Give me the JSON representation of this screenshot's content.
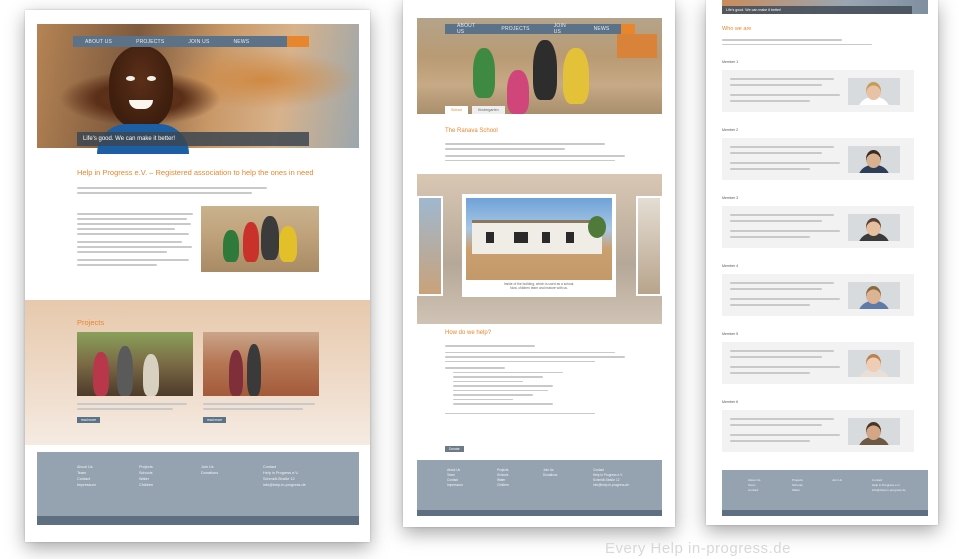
{
  "page1": {
    "nav": [
      "ABOUT US",
      "PROJECTS",
      "JOIN US",
      "NEWS"
    ],
    "hero_caption": "Life's good. We can make it better!",
    "headline": "Help in Progress e.V. – Registered association to help the ones in need",
    "projects_title": "Projects",
    "read_more": "read more",
    "footer": {
      "col1": [
        "About Us",
        "Team",
        "Contact",
        "Impressum"
      ],
      "col2": [
        "Projects",
        "Schools",
        "Water",
        "Children"
      ],
      "col3": [
        "Join Us",
        "Donations"
      ],
      "col4": [
        "Contact",
        "Help in Progress e.V.",
        "Schmidt-Straße 12",
        "info@help-in-progress.de"
      ]
    }
  },
  "page2": {
    "nav": [
      "ABOUT US",
      "PROJECTS",
      "JOIN US",
      "NEWS"
    ],
    "tabs": [
      "School",
      "Kindergarten"
    ],
    "title": "The Ranava School",
    "gallery_caption": "Inside of the building, which is used as a school.",
    "gallery_caption2": "Now, children learn and mature with us.",
    "howto_title": "How do we help?",
    "button": "Donate",
    "footer": {
      "col1": [
        "About Us",
        "Team",
        "Contact",
        "Impressum"
      ],
      "col2": [
        "Projects",
        "Schools",
        "Water",
        "Children"
      ],
      "col3": [
        "Join Us",
        "Donations"
      ],
      "col4": [
        "Contact",
        "Help in Progress e.V.",
        "Schmidt-Straße 12",
        "info@help-in-progress.de"
      ]
    }
  },
  "page3": {
    "hero_caption": "Life's good. We can make it better!",
    "title": "Who we are",
    "members": [
      "Member 1",
      "Member 2",
      "Member 3",
      "Member 4",
      "Member 5",
      "Member 6"
    ],
    "footer": {
      "col1": [
        "About Us",
        "Team",
        "Contact"
      ],
      "col2": [
        "Projects",
        "Schools",
        "Water"
      ],
      "col3": [
        "Join Us"
      ],
      "col4": [
        "Contact",
        "Help in Progress e.V.",
        "info@help-in-progress.de"
      ]
    }
  },
  "watermark": "Every Help in-progress.de",
  "colors": {
    "accent": "#e8862e",
    "nav": "#5c7288",
    "footer": "#95a3b1"
  }
}
